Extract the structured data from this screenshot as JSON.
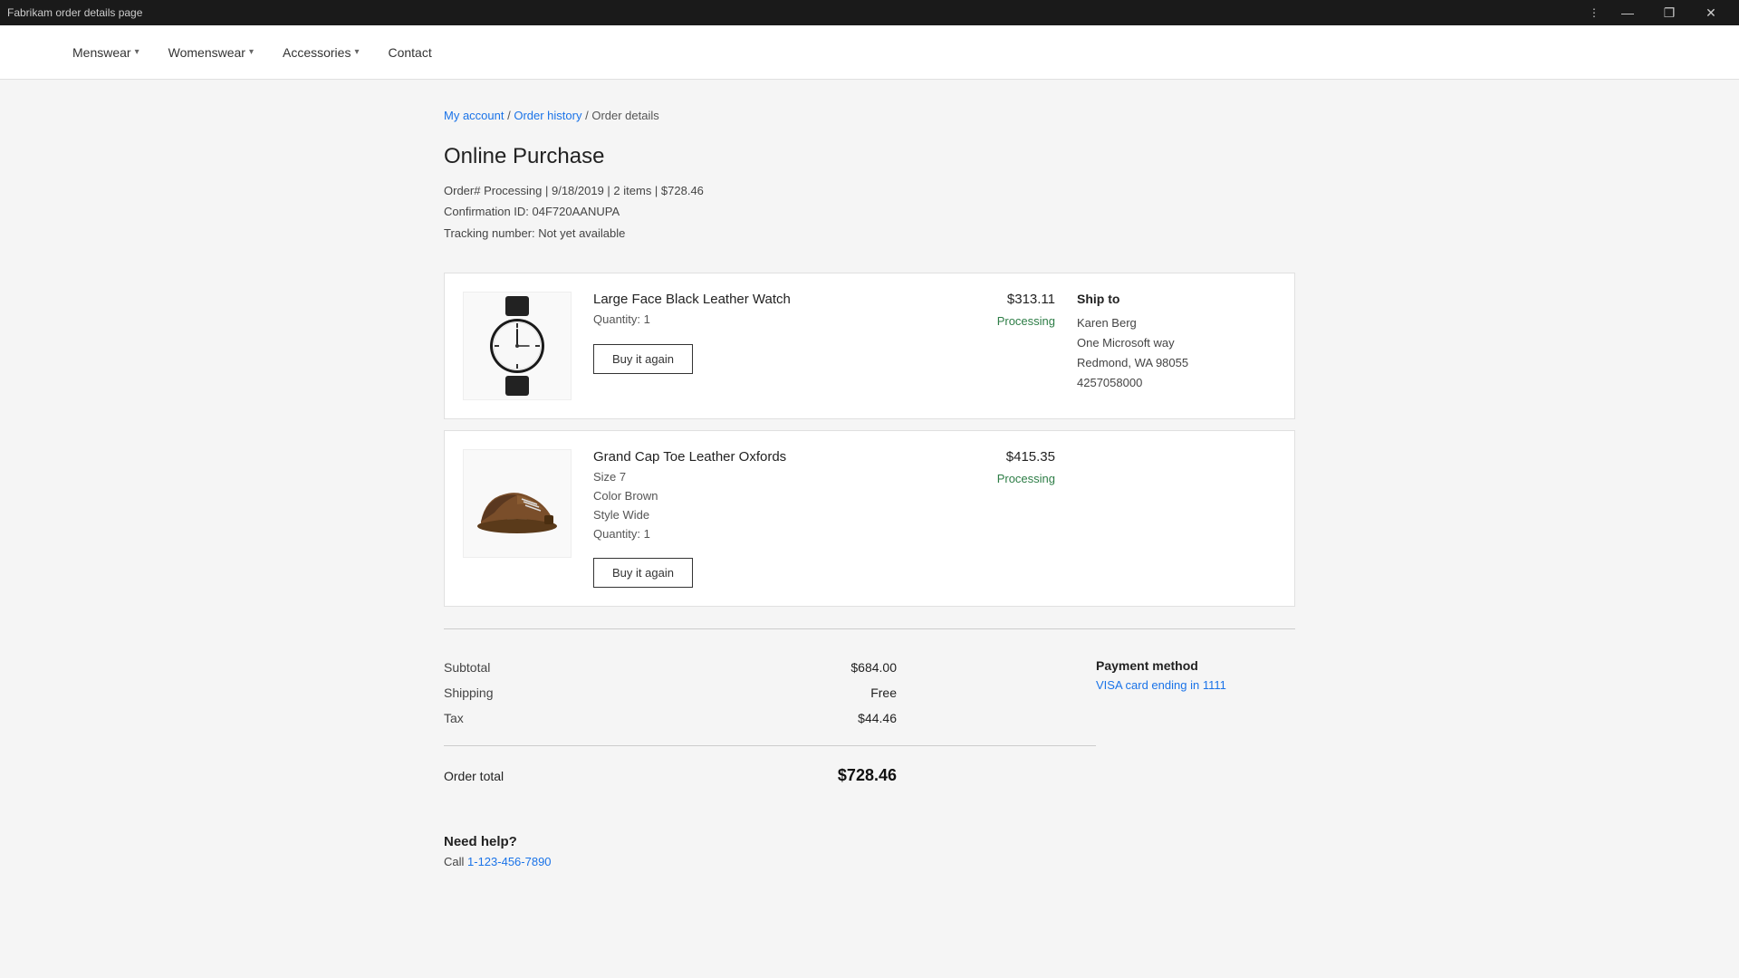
{
  "titleBar": {
    "title": "Fabrikam order details page",
    "menuIcon": "⋮",
    "minimizeIcon": "—",
    "restoreIcon": "❐",
    "closeIcon": "✕"
  },
  "nav": {
    "items": [
      {
        "label": "Menswear",
        "hasDropdown": true
      },
      {
        "label": "Womenswear",
        "hasDropdown": true
      },
      {
        "label": "Accessories",
        "hasDropdown": true
      },
      {
        "label": "Contact",
        "hasDropdown": false
      }
    ]
  },
  "breadcrumb": {
    "myAccount": "My account",
    "separator1": " / ",
    "orderHistory": "Order history",
    "separator2": "/ ",
    "current": "Order details"
  },
  "pageTitle": "Online Purchase",
  "orderMeta": {
    "line1": "Order# Processing | 9/18/2019 | 2 items | $728.46",
    "line2": "Confirmation ID: 04F720AANUPA",
    "line3": "Tracking number: Not yet available"
  },
  "items": [
    {
      "name": "Large Face Black Leather Watch",
      "quantity": "Quantity: 1",
      "price": "$313.11",
      "status": "Processing",
      "buyAgainLabel": "Buy it again",
      "imageType": "watch"
    },
    {
      "name": "Grand Cap Toe Leather Oxfords",
      "size": "Size 7",
      "color": "Color Brown",
      "style": "Style Wide",
      "quantity": "Quantity: 1",
      "price": "$415.35",
      "status": "Processing",
      "buyAgainLabel": "Buy it again",
      "imageType": "shoe"
    }
  ],
  "shipTo": {
    "label": "Ship to",
    "name": "Karen Berg",
    "address1": "One Microsoft way",
    "address2": "Redmond, WA 98055",
    "phone": "4257058000"
  },
  "summary": {
    "subtotalLabel": "Subtotal",
    "subtotalValue": "$684.00",
    "shippingLabel": "Shipping",
    "shippingValue": "Free",
    "taxLabel": "Tax",
    "taxValue": "$44.46",
    "totalLabel": "Order total",
    "totalValue": "$728.46"
  },
  "payment": {
    "label": "Payment method",
    "value": "VISA card ending in ",
    "cardEnd": "1111"
  },
  "help": {
    "title": "Need help?",
    "callText": "Call ",
    "phone": "1-123-456-7890"
  },
  "colors": {
    "statusGreen": "#2d7d46",
    "linkBlue": "#1a73e8"
  }
}
